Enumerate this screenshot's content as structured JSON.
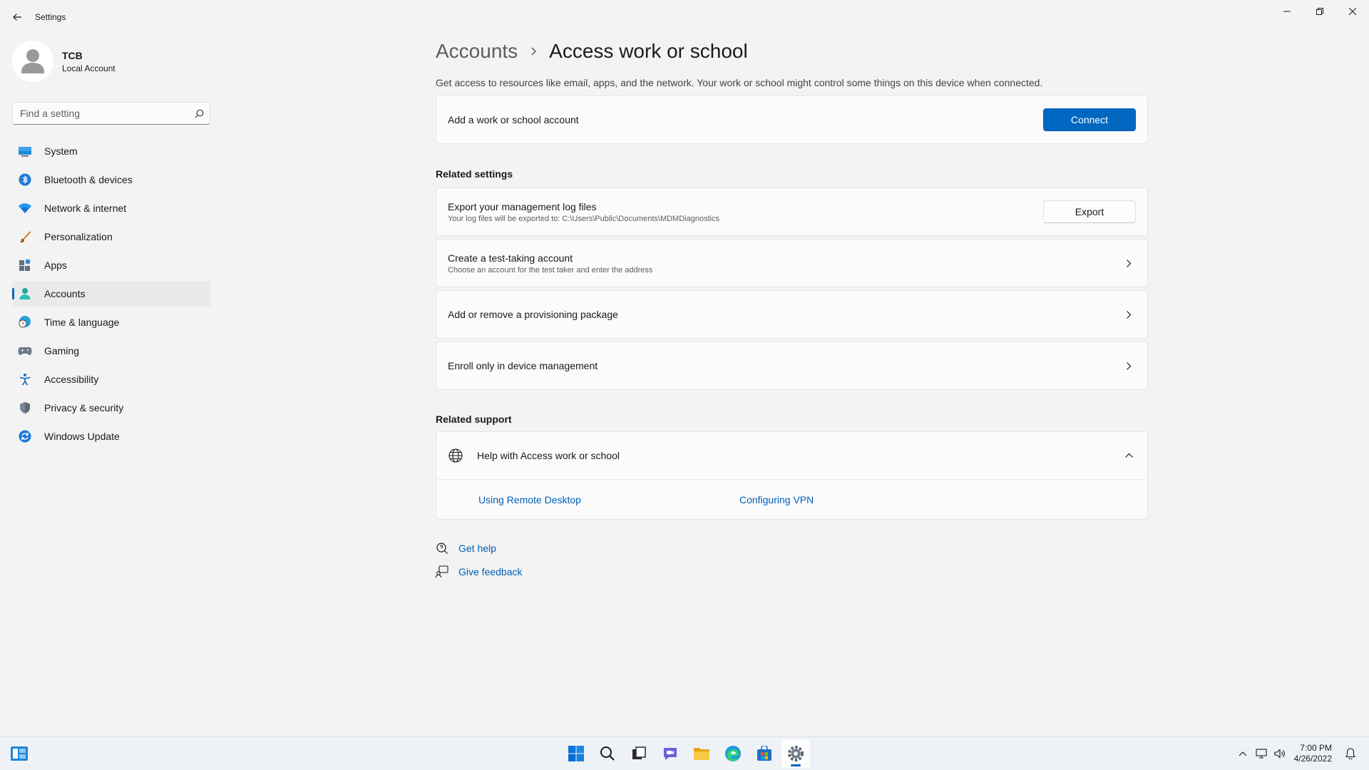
{
  "window": {
    "title": "Settings",
    "back_label": "Back",
    "minimize_label": "Minimize",
    "maximize_label": "Restore",
    "close_label": "Close"
  },
  "profile": {
    "name": "TCB",
    "account_type": "Local Account"
  },
  "search": {
    "placeholder": "Find a setting",
    "value": ""
  },
  "sidebar": {
    "items": [
      {
        "label": "System",
        "icon": "display-icon"
      },
      {
        "label": "Bluetooth & devices",
        "icon": "bluetooth-icon"
      },
      {
        "label": "Network & internet",
        "icon": "wifi-icon"
      },
      {
        "label": "Personalization",
        "icon": "brush-icon"
      },
      {
        "label": "Apps",
        "icon": "apps-icon"
      },
      {
        "label": "Accounts",
        "icon": "person-icon",
        "selected": true
      },
      {
        "label": "Time & language",
        "icon": "globe-clock-icon"
      },
      {
        "label": "Gaming",
        "icon": "gamepad-icon"
      },
      {
        "label": "Accessibility",
        "icon": "accessibility-icon"
      },
      {
        "label": "Privacy & security",
        "icon": "shield-icon"
      },
      {
        "label": "Windows Update",
        "icon": "update-icon"
      }
    ]
  },
  "main": {
    "breadcrumb_parent": "Accounts",
    "breadcrumb_current": "Access work or school",
    "description": "Get access to resources like email, apps, and the network. Your work or school might control some things on this device when connected.",
    "add_account": {
      "label": "Add a work or school account",
      "button": "Connect"
    },
    "related_settings": {
      "heading": "Related settings",
      "export": {
        "title": "Export your management log files",
        "subtitle": "Your log files will be exported to: C:\\Users\\Public\\Documents\\MDMDiagnostics",
        "button": "Export"
      },
      "test_account": {
        "title": "Create a test-taking account",
        "subtitle": "Choose an account for the test taker and enter the address"
      },
      "provisioning": {
        "title": "Add or remove a provisioning package"
      },
      "enroll": {
        "title": "Enroll only in device management"
      }
    },
    "related_support": {
      "heading": "Related support",
      "help_title": "Help with Access work or school",
      "expanded": true,
      "links": [
        "Using Remote Desktop",
        "Configuring VPN"
      ]
    },
    "footer": {
      "get_help": "Get help",
      "give_feedback": "Give feedback"
    }
  },
  "taskbar": {
    "apps": [
      "start-icon",
      "search-icon",
      "task-view-icon",
      "chat-icon",
      "file-explorer-icon",
      "edge-icon",
      "store-icon",
      "settings-icon"
    ],
    "active_app": "settings-icon",
    "time": "7:00 PM",
    "date": "4/26/2022"
  },
  "colors": {
    "accent": "#0067c0",
    "background": "#f3f3f3",
    "card": "#fbfbfb",
    "link": "#005fb8"
  }
}
